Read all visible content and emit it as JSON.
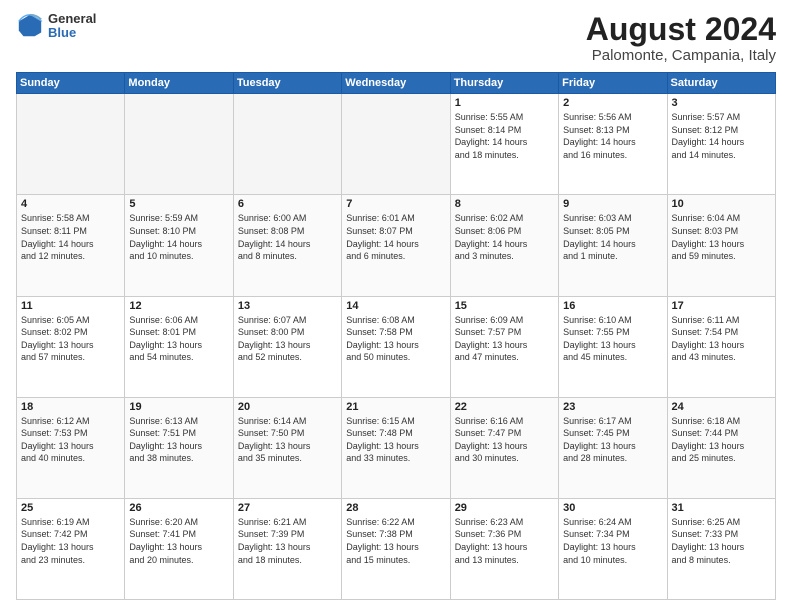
{
  "header": {
    "logo_general": "General",
    "logo_blue": "Blue",
    "title": "August 2024",
    "location": "Palomonte, Campania, Italy"
  },
  "days_of_week": [
    "Sunday",
    "Monday",
    "Tuesday",
    "Wednesday",
    "Thursday",
    "Friday",
    "Saturday"
  ],
  "weeks": [
    [
      {
        "day": "",
        "info": ""
      },
      {
        "day": "",
        "info": ""
      },
      {
        "day": "",
        "info": ""
      },
      {
        "day": "",
        "info": ""
      },
      {
        "day": "1",
        "info": "Sunrise: 5:55 AM\nSunset: 8:14 PM\nDaylight: 14 hours\nand 18 minutes."
      },
      {
        "day": "2",
        "info": "Sunrise: 5:56 AM\nSunset: 8:13 PM\nDaylight: 14 hours\nand 16 minutes."
      },
      {
        "day": "3",
        "info": "Sunrise: 5:57 AM\nSunset: 8:12 PM\nDaylight: 14 hours\nand 14 minutes."
      }
    ],
    [
      {
        "day": "4",
        "info": "Sunrise: 5:58 AM\nSunset: 8:11 PM\nDaylight: 14 hours\nand 12 minutes."
      },
      {
        "day": "5",
        "info": "Sunrise: 5:59 AM\nSunset: 8:10 PM\nDaylight: 14 hours\nand 10 minutes."
      },
      {
        "day": "6",
        "info": "Sunrise: 6:00 AM\nSunset: 8:08 PM\nDaylight: 14 hours\nand 8 minutes."
      },
      {
        "day": "7",
        "info": "Sunrise: 6:01 AM\nSunset: 8:07 PM\nDaylight: 14 hours\nand 6 minutes."
      },
      {
        "day": "8",
        "info": "Sunrise: 6:02 AM\nSunset: 8:06 PM\nDaylight: 14 hours\nand 3 minutes."
      },
      {
        "day": "9",
        "info": "Sunrise: 6:03 AM\nSunset: 8:05 PM\nDaylight: 14 hours\nand 1 minute."
      },
      {
        "day": "10",
        "info": "Sunrise: 6:04 AM\nSunset: 8:03 PM\nDaylight: 13 hours\nand 59 minutes."
      }
    ],
    [
      {
        "day": "11",
        "info": "Sunrise: 6:05 AM\nSunset: 8:02 PM\nDaylight: 13 hours\nand 57 minutes."
      },
      {
        "day": "12",
        "info": "Sunrise: 6:06 AM\nSunset: 8:01 PM\nDaylight: 13 hours\nand 54 minutes."
      },
      {
        "day": "13",
        "info": "Sunrise: 6:07 AM\nSunset: 8:00 PM\nDaylight: 13 hours\nand 52 minutes."
      },
      {
        "day": "14",
        "info": "Sunrise: 6:08 AM\nSunset: 7:58 PM\nDaylight: 13 hours\nand 50 minutes."
      },
      {
        "day": "15",
        "info": "Sunrise: 6:09 AM\nSunset: 7:57 PM\nDaylight: 13 hours\nand 47 minutes."
      },
      {
        "day": "16",
        "info": "Sunrise: 6:10 AM\nSunset: 7:55 PM\nDaylight: 13 hours\nand 45 minutes."
      },
      {
        "day": "17",
        "info": "Sunrise: 6:11 AM\nSunset: 7:54 PM\nDaylight: 13 hours\nand 43 minutes."
      }
    ],
    [
      {
        "day": "18",
        "info": "Sunrise: 6:12 AM\nSunset: 7:53 PM\nDaylight: 13 hours\nand 40 minutes."
      },
      {
        "day": "19",
        "info": "Sunrise: 6:13 AM\nSunset: 7:51 PM\nDaylight: 13 hours\nand 38 minutes."
      },
      {
        "day": "20",
        "info": "Sunrise: 6:14 AM\nSunset: 7:50 PM\nDaylight: 13 hours\nand 35 minutes."
      },
      {
        "day": "21",
        "info": "Sunrise: 6:15 AM\nSunset: 7:48 PM\nDaylight: 13 hours\nand 33 minutes."
      },
      {
        "day": "22",
        "info": "Sunrise: 6:16 AM\nSunset: 7:47 PM\nDaylight: 13 hours\nand 30 minutes."
      },
      {
        "day": "23",
        "info": "Sunrise: 6:17 AM\nSunset: 7:45 PM\nDaylight: 13 hours\nand 28 minutes."
      },
      {
        "day": "24",
        "info": "Sunrise: 6:18 AM\nSunset: 7:44 PM\nDaylight: 13 hours\nand 25 minutes."
      }
    ],
    [
      {
        "day": "25",
        "info": "Sunrise: 6:19 AM\nSunset: 7:42 PM\nDaylight: 13 hours\nand 23 minutes."
      },
      {
        "day": "26",
        "info": "Sunrise: 6:20 AM\nSunset: 7:41 PM\nDaylight: 13 hours\nand 20 minutes."
      },
      {
        "day": "27",
        "info": "Sunrise: 6:21 AM\nSunset: 7:39 PM\nDaylight: 13 hours\nand 18 minutes."
      },
      {
        "day": "28",
        "info": "Sunrise: 6:22 AM\nSunset: 7:38 PM\nDaylight: 13 hours\nand 15 minutes."
      },
      {
        "day": "29",
        "info": "Sunrise: 6:23 AM\nSunset: 7:36 PM\nDaylight: 13 hours\nand 13 minutes."
      },
      {
        "day": "30",
        "info": "Sunrise: 6:24 AM\nSunset: 7:34 PM\nDaylight: 13 hours\nand 10 minutes."
      },
      {
        "day": "31",
        "info": "Sunrise: 6:25 AM\nSunset: 7:33 PM\nDaylight: 13 hours\nand 8 minutes."
      }
    ]
  ]
}
